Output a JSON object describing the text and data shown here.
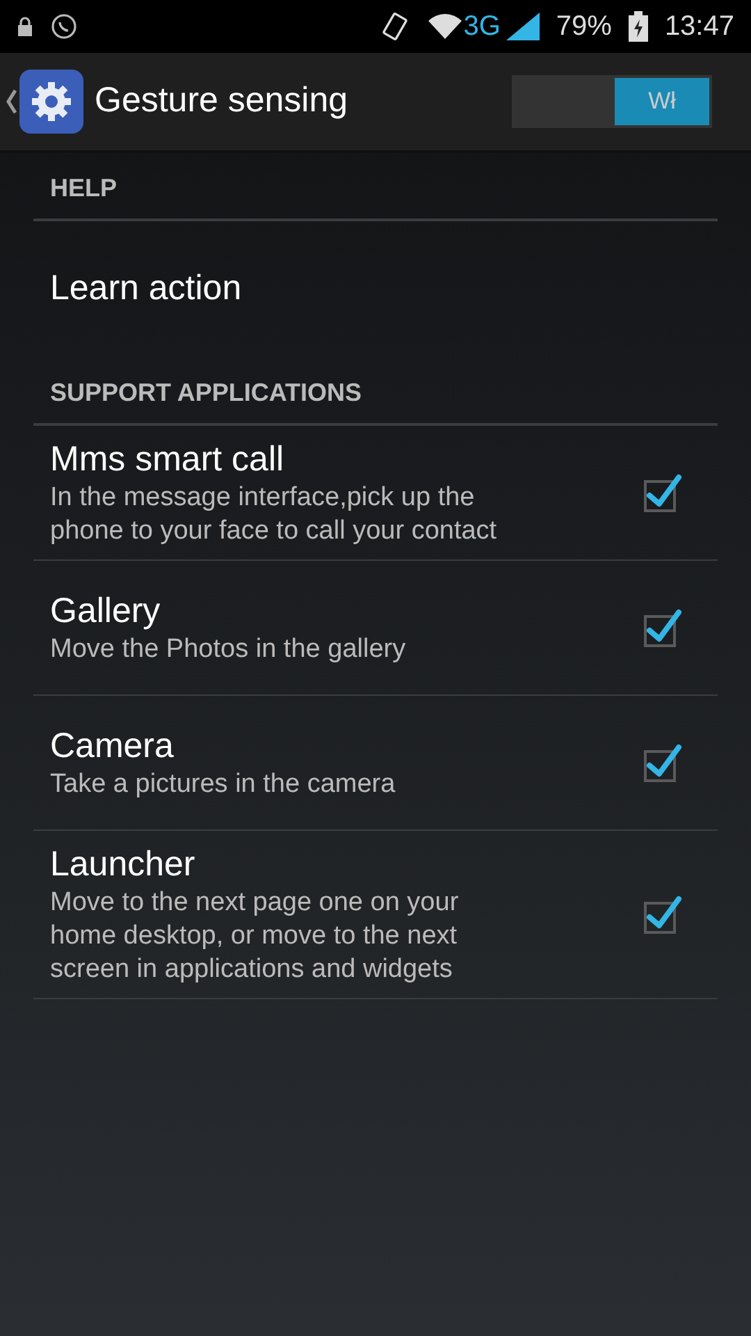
{
  "status_bar": {
    "network": "3G",
    "battery": "79%",
    "time": "13:47"
  },
  "action_bar": {
    "title": "Gesture sensing",
    "switch": {
      "label": "Wł",
      "on": true
    }
  },
  "sections": [
    {
      "header": "HELP",
      "items": [
        {
          "kind": "action",
          "title": "Learn action"
        }
      ]
    },
    {
      "header": "SUPPORT APPLICATIONS",
      "items": [
        {
          "kind": "checkbox",
          "title": "Mms smart call",
          "summary": "In the message interface,pick up the phone to your face to call your contact",
          "checked": true
        },
        {
          "kind": "checkbox",
          "title": "Gallery",
          "summary": "Move the Photos in the gallery",
          "checked": true
        },
        {
          "kind": "checkbox",
          "title": "Camera",
          "summary": "Take a pictures in the camera",
          "checked": true
        },
        {
          "kind": "checkbox",
          "title": "Launcher",
          "summary": "Move to the next page one on your home desktop, or move to the next screen in applications and widgets",
          "checked": true
        }
      ]
    }
  ]
}
